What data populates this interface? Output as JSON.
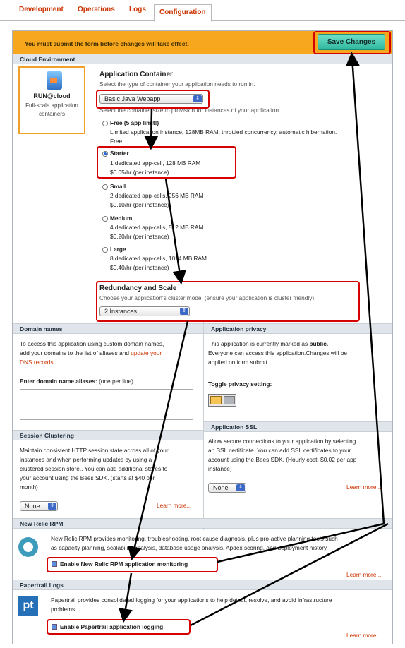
{
  "tabs": [
    "Development",
    "Operations",
    "Logs",
    "Configuration"
  ],
  "banner": {
    "message": "You must submit the form before changes will take effect.",
    "save_label": "Save Changes"
  },
  "cloud_environment": {
    "section_title": "Cloud Environment",
    "provider_name": "RUN@cloud",
    "provider_description": "Full-scale application containers",
    "app_container_title": "Application Container",
    "app_container_help": "Select the type of container your application needs to run in.",
    "container_type": "Basic Java Webapp",
    "size_help": "Select the container size to provision for instances of your application.",
    "sizes": [
      {
        "name": "Free (5 app limit!)",
        "detail1": "Limited application instance, 128MB RAM, throttled concurrency, automatic hibernation.",
        "detail2": "Free"
      },
      {
        "name": "Starter",
        "detail1": "1 dedicated app-cell, 128 MB RAM",
        "detail2": "$0.05/hr (per instance)"
      },
      {
        "name": "Small",
        "detail1": "2 dedicated app-cells, 256 MB RAM",
        "detail2": "$0.10/hr (per instance)"
      },
      {
        "name": "Medium",
        "detail1": "4 dedicated app-cells, 512 MB RAM",
        "detail2": "$0.20/hr (per instance)"
      },
      {
        "name": "Large",
        "detail1": "8 dedicated app-cells, 1024 MB RAM",
        "detail2": "$0.40/hr (per instance)"
      }
    ],
    "redundancy_title": "Redundancy and Scale",
    "redundancy_help": "Choose your application's cluster model (ensure your application is cluster friendly).",
    "instances": "2 Instances"
  },
  "domain_names": {
    "title": "Domain names",
    "text1": "To access this application using custom domain names,",
    "text2": "add your domains to the list of aliases and",
    "link1": "update your",
    "link2": "DNS records",
    "alias_label": "Enter domain name aliases:",
    "alias_hint": "(one per line)"
  },
  "privacy": {
    "title": "Application privacy",
    "text1": "This application is currently marked as",
    "state": "public.",
    "text2": "Everyone can access this application.Changes will be",
    "text3": "applied on form submit.",
    "toggle_label": "Toggle privacy setting:"
  },
  "session_clustering": {
    "title": "Session Clustering",
    "line1": "Maintain consistent HTTP session state across all of your",
    "line2": "instances and when performing updates by using a",
    "line3": "clustered session store.. You can add additional stores to",
    "line4": "your account using the Bees SDK. (starts at $40 per",
    "line5": "month)",
    "select": "None",
    "learn_more": "Learn more..."
  },
  "ssl": {
    "title": "Application SSL",
    "line1": "Allow secure connections to your application by selecting",
    "line2": "an SSL certificate. You can add SSL certificates to your",
    "line3": "account using the Bees SDK. (Hourly cost: $0.02 per app",
    "line4": "instance)",
    "select": "None",
    "learn_more": "Learn more..."
  },
  "newrelic": {
    "title": "New Relic RPM",
    "line1": "New Relic RPM provides monitoring, troubleshooting, root cause diagnosis, plus pro-active planning tools such",
    "line2": "as capacity planning, scalability analysis, database usage analysis, Apdex scoring, and deployment history.",
    "checkbox": "Enable New Relic RPM application monitoring",
    "learn_more": "Learn more..."
  },
  "papertrail": {
    "title": "Papertrail Logs",
    "line1": "Papertrail provides consolidated logging for your applications to help detect, resolve, and avoid infrastructure",
    "line2": "problems.",
    "checkbox": "Enable Papertrail application logging",
    "learn_more": "Learn more...",
    "logo_text": "pt"
  },
  "colors": {
    "accent": "#cc3300",
    "banner": "#f7a71e",
    "highlight": "#d50000"
  }
}
